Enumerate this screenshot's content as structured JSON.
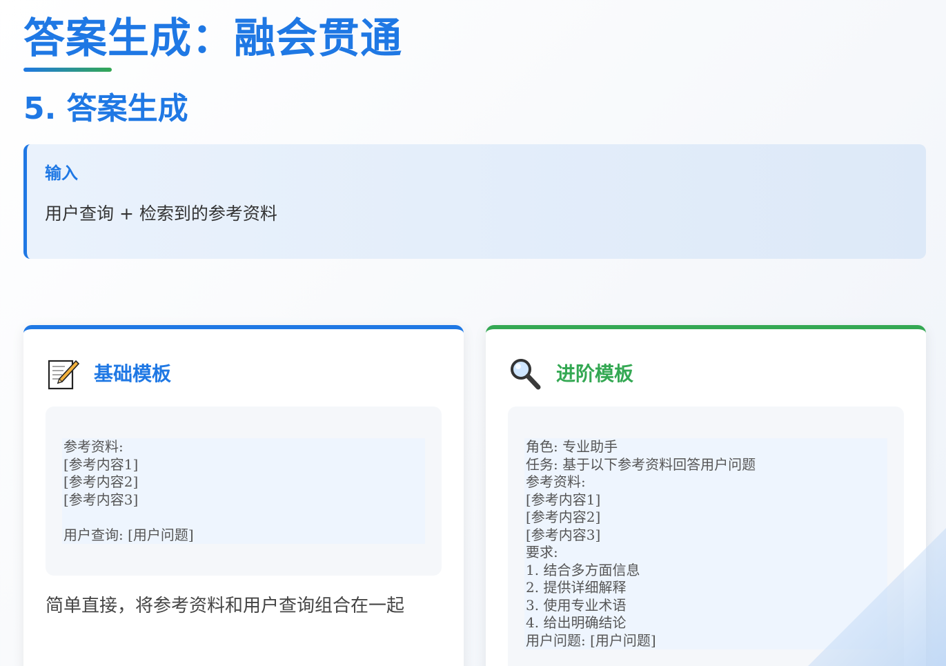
{
  "page": {
    "title": "答案生成：融会贯通",
    "section_heading": "5. 答案生成"
  },
  "input_box": {
    "label": "输入",
    "text": "用户查询 + 检索到的参考资料"
  },
  "cards": [
    {
      "icon": "memo-icon",
      "title": "基础模板",
      "accent": "#1f78e4",
      "code": "参考资料:\n[参考内容1]\n[参考内容2]\n[参考内容3]\n\n用户查询: [用户问题]",
      "description": "简单直接，将参考资料和用户查询组合在一起"
    },
    {
      "icon": "magnifier-icon",
      "title": "进阶模板",
      "accent": "#34a853",
      "code": "角色: 专业助手\n任务: 基于以下参考资料回答用户问题\n参考资料:\n[参考内容1]\n[参考内容2]\n[参考内容3]\n要求:\n1. 结合多方面信息\n2. 提供详细解释\n3. 使用专业术语\n4. 给出明确结论\n用户问题: [用户问题]"
    }
  ]
}
